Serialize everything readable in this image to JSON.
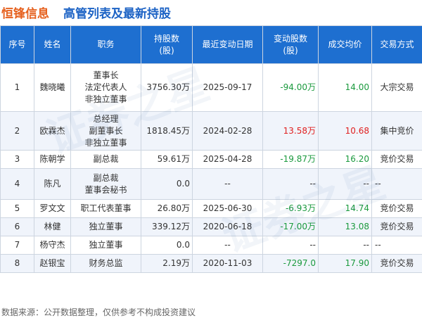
{
  "header": {
    "company": "恒锋信息",
    "title": "高管列表及最新持股"
  },
  "table": {
    "headers": [
      [
        "序号"
      ],
      [
        "姓名"
      ],
      [
        "职务"
      ],
      [
        "持股数",
        "(股)"
      ],
      [
        "最近变动日期"
      ],
      [
        "变动股数",
        "(股)"
      ],
      [
        "成交均价"
      ],
      [
        "交易方式"
      ]
    ],
    "rows": [
      {
        "idx": "1",
        "name": "魏晓曦",
        "roles": [
          "董事长",
          "法定代表人",
          "非独立董事"
        ],
        "shares": "3756.30万",
        "date": "2025-09-17",
        "change": "-94.00万",
        "change_sign": "neg",
        "price": "14.00",
        "price_sign": "neg",
        "method": "大宗交易"
      },
      {
        "idx": "2",
        "name": "欧霖杰",
        "roles": [
          "总经理",
          "副董事长",
          "非独立董事"
        ],
        "shares": "1818.45万",
        "date": "2024-02-28",
        "change": "13.58万",
        "change_sign": "pos",
        "price": "10.68",
        "price_sign": "pos",
        "method": "集中竞价"
      },
      {
        "idx": "3",
        "name": "陈朝学",
        "roles": [
          "副总裁"
        ],
        "shares": "59.61万",
        "date": "2025-04-28",
        "change": "-19.87万",
        "change_sign": "neg",
        "price": "16.20",
        "price_sign": "neg",
        "method": "竞价交易"
      },
      {
        "idx": "4",
        "name": "陈凡",
        "roles": [
          "副总裁",
          "董事会秘书"
        ],
        "shares": "0.0",
        "date": "--",
        "change": "--",
        "change_sign": "none",
        "price": "--",
        "price_sign": "none",
        "method": "--"
      },
      {
        "idx": "5",
        "name": "罗文文",
        "roles": [
          "职工代表董事"
        ],
        "shares": "26.80万",
        "date": "2025-06-30",
        "change": "-6.93万",
        "change_sign": "neg",
        "price": "14.74",
        "price_sign": "neg",
        "method": "竞价交易"
      },
      {
        "idx": "6",
        "name": "林健",
        "roles": [
          "独立董事"
        ],
        "shares": "339.12万",
        "date": "2020-06-18",
        "change": "-17.00万",
        "change_sign": "neg",
        "price": "13.08",
        "price_sign": "neg",
        "method": "竞价交易"
      },
      {
        "idx": "7",
        "name": "杨守杰",
        "roles": [
          "独立董事"
        ],
        "shares": "0.0",
        "date": "--",
        "change": "--",
        "change_sign": "none",
        "price": "--",
        "price_sign": "none",
        "method": "--"
      },
      {
        "idx": "8",
        "name": "赵银宝",
        "roles": [
          "财务总监"
        ],
        "shares": "2.19万",
        "date": "2020-11-03",
        "change": "-7297.0",
        "change_sign": "neg",
        "price": "17.90",
        "price_sign": "neg",
        "method": "竞价交易"
      }
    ]
  },
  "footer": {
    "source": "数据来源：公开数据整理，仅供参考不构成投资建议"
  },
  "watermark": {
    "text": "证券之星"
  },
  "colors": {
    "company": "#e6611f",
    "title": "#1d63c5",
    "header_bg": "#1e6fd0",
    "positive": "#e02020",
    "negative": "#1b9a3e"
  }
}
